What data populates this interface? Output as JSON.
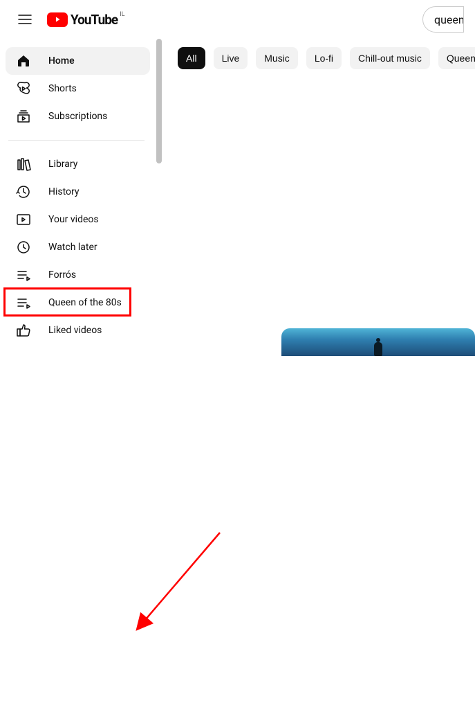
{
  "header": {
    "logo_text": "YouTube",
    "region": "IL",
    "search_value": "queen"
  },
  "sidebar": {
    "section1": [
      {
        "label": "Home",
        "icon": "home",
        "selected": true
      },
      {
        "label": "Shorts",
        "icon": "shorts",
        "selected": false
      },
      {
        "label": "Subscriptions",
        "icon": "subscriptions",
        "selected": false
      }
    ],
    "section2": [
      {
        "label": "Library",
        "icon": "library"
      },
      {
        "label": "History",
        "icon": "history"
      },
      {
        "label": "Your videos",
        "icon": "your-videos"
      },
      {
        "label": "Watch later",
        "icon": "watch-later"
      },
      {
        "label": "Forrós",
        "icon": "playlist"
      },
      {
        "label": "Queen of the 80s",
        "icon": "playlist"
      },
      {
        "label": "Liked videos",
        "icon": "liked"
      }
    ]
  },
  "chips": [
    {
      "label": "All",
      "active": true
    },
    {
      "label": "Live",
      "active": false
    },
    {
      "label": "Music",
      "active": false
    },
    {
      "label": "Lo-fi",
      "active": false
    },
    {
      "label": "Chill-out music",
      "active": false
    },
    {
      "label": "Queen",
      "active": false
    }
  ],
  "annotation": {
    "highlighted_item": "Queen of the 80s"
  }
}
